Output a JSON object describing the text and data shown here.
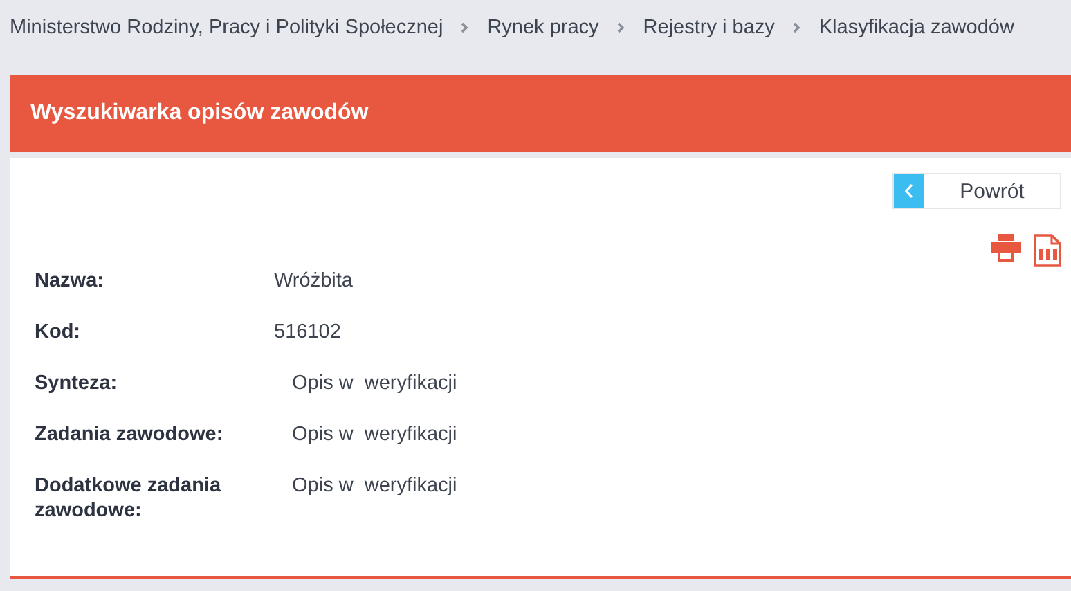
{
  "breadcrumb": [
    "Ministerstwo Rodziny, Pracy i Polityki Społecznej",
    "Rynek pracy",
    "Rejestry i bazy",
    "Klasyfikacja zawodów"
  ],
  "panel": {
    "title": "Wyszukiwarka opisów zawodów",
    "back_button": "Powrót",
    "basic": [
      {
        "label": "Nazwa:",
        "value": "Wróżbita"
      },
      {
        "label": "Kod:",
        "value": "516102"
      }
    ],
    "description": [
      {
        "label": "Synteza:",
        "value": "Opis w  weryfikacji"
      },
      {
        "label": "Zadania zawodowe:",
        "value": "Opis w  weryfikacji"
      },
      {
        "label": "Dodatkowe zadania zawodowe:",
        "value": "Opis w  weryfikacji"
      }
    ]
  }
}
